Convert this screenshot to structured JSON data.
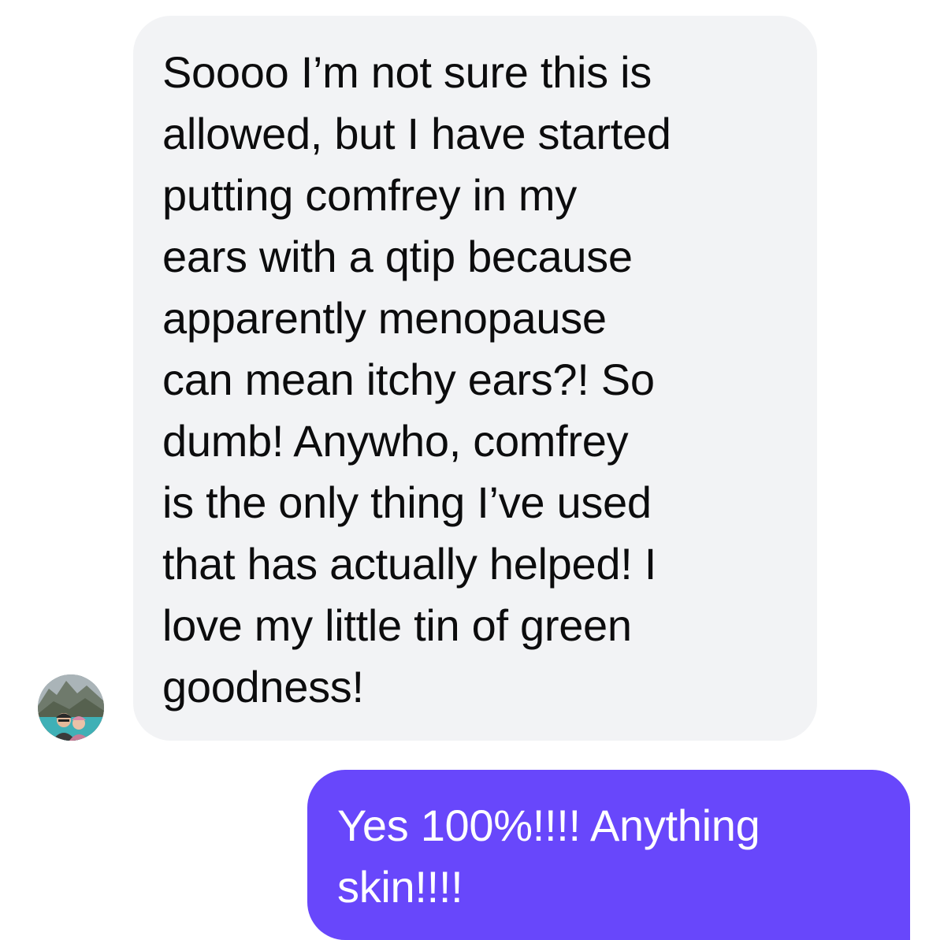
{
  "messages": {
    "incoming": {
      "text": "Soooo I’m not sure this is\nallowed, but I have started\nputting comfrey in my\nears with a qtip because\napparently menopause\ncan mean itchy ears?! So\ndumb! Anywho, comfrey\nis the only thing I’ve used\nthat has  actually helped! I\nlove my little tin of green\ngoodness!"
    },
    "outgoing": {
      "text": "Yes 100%!!!! Anything\nskin!!!!"
    }
  },
  "colors": {
    "incoming_bubble": "#f2f3f5",
    "outgoing_bubble": "#6847fb",
    "incoming_text": "#0c0c0d",
    "outgoing_text": "#ffffff"
  },
  "icons": {
    "avatar": "user-avatar-photo"
  }
}
